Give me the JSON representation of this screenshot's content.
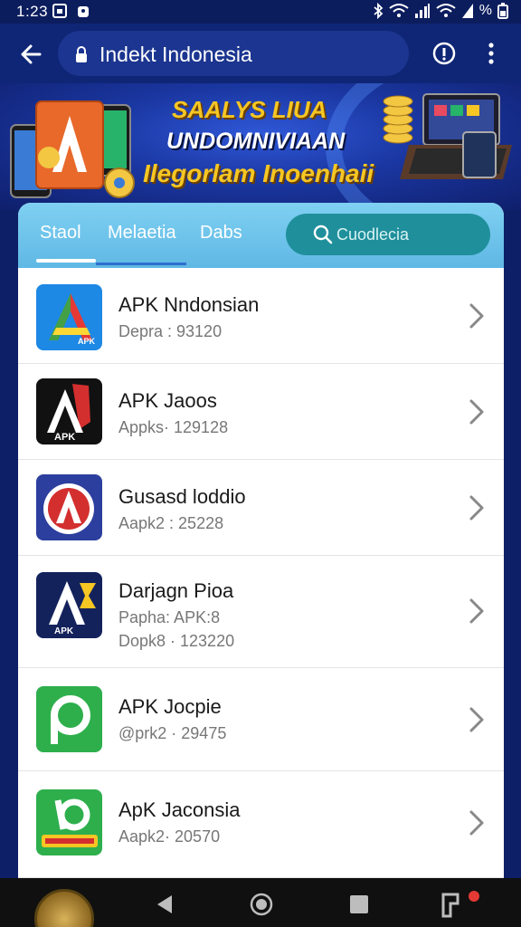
{
  "status_bar": {
    "time": "1:23",
    "battery_label": "%"
  },
  "browser": {
    "url": "Indekt Indonesia"
  },
  "banner": {
    "line1": "SAALYS LIUA",
    "line2": "UNDOMNIVIAAN",
    "line3": "Ilegorlam Inoenhaii"
  },
  "tabs": [
    {
      "label": "Staol",
      "active": true
    },
    {
      "label": "Melaetia",
      "active": false
    },
    {
      "label": "Dabs",
      "active": false
    }
  ],
  "search": {
    "placeholder": "Cuodlecia"
  },
  "apps": [
    {
      "title": "APK Nndonsian",
      "lines": [
        "Depra : 93120"
      ],
      "icon": "apk-triangle-blue-icon"
    },
    {
      "title": "APK Jaoos",
      "lines": [
        "Appks· 129128"
      ],
      "icon": "apk-black-red-icon"
    },
    {
      "title": "Gusasd loddio",
      "lines": [
        "Aapk2 : 25228"
      ],
      "icon": "apk-red-shield-icon"
    },
    {
      "title": "Darjagn Pioa",
      "lines": [
        "Papha: APK:8",
        "Dopk8 · 123220"
      ],
      "icon": "apk-navy-a3-icon"
    },
    {
      "title": "APK Jocpie",
      "lines": [
        "@prk2 · 29475"
      ],
      "icon": "apk-green-p-icon"
    },
    {
      "title": "ApK Jaconsia",
      "lines": [
        "Aapk2· 20570"
      ],
      "icon": "apk-green-yellow-icon"
    }
  ],
  "colors": {
    "accent": "#5fb8e4",
    "search_bg": "#1f8f9c",
    "banner_gold": "#f6c623",
    "background": "#0d1f66"
  }
}
